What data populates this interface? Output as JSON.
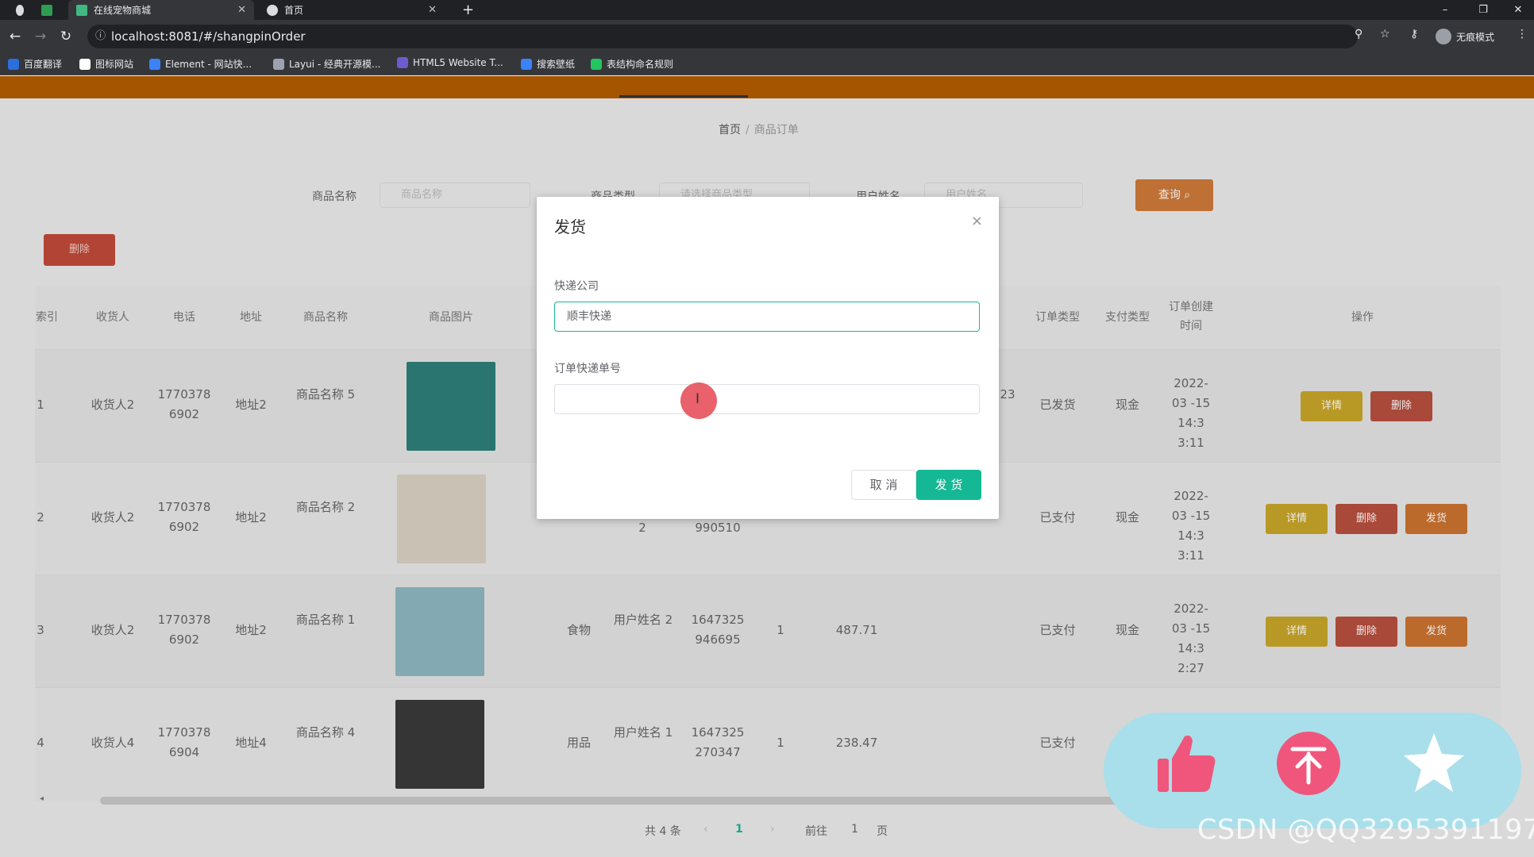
{
  "browser": {
    "tabs": [
      {
        "title": "在线宠物商城",
        "active": true
      },
      {
        "title": "首页",
        "active": false
      }
    ],
    "new_tab": "+",
    "window_controls": [
      "–",
      "❐",
      "✕"
    ],
    "url": "localhost:8081/#/shangpinOrder",
    "incognito_label": "无痕模式",
    "bookmarks": [
      {
        "label": "百度翻译",
        "color": "#2a6fdb"
      },
      {
        "label": "图标网站",
        "color": "#ffffff"
      },
      {
        "label": "Element - 网站快...",
        "color": "#3b82f6"
      },
      {
        "label": "Layui - 经典开源模...",
        "color": "#9ca3af"
      },
      {
        "label": "HTML5 Website T...",
        "color": "#6d5bd0"
      },
      {
        "label": "搜索壁纸",
        "color": "#3b82f6"
      },
      {
        "label": "表结构命名规则",
        "color": "#22c55e"
      }
    ]
  },
  "page": {
    "breadcrumb": {
      "home": "首页",
      "separator": "/",
      "current": "商品订单"
    },
    "search": {
      "fields": [
        {
          "label": "商品名称",
          "placeholder": "商品名称"
        },
        {
          "label": "商品类型",
          "placeholder": "请选择商品类型"
        },
        {
          "label": "用户姓名",
          "placeholder": "用户姓名"
        }
      ],
      "query_button": "查询 ⌕"
    },
    "delete_button": "删除",
    "table": {
      "headers": [
        "索引",
        "收货人",
        "电话",
        "地址",
        "商品名称",
        "商品图片",
        "订单类型",
        "支付类型",
        "订单创建时间",
        "操作"
      ],
      "rows": [
        {
          "index": "1",
          "receiver": "收货人2",
          "phone": "1770378 6902",
          "address": "地址2",
          "product": "商品名称 5",
          "type": "",
          "user": "",
          "order_no": "",
          "qty": "",
          "price": "",
          "extra": "23",
          "status": "已发货",
          "pay": "现金",
          "created": "2022-03 -15 14:3 3:11",
          "thumb_color": "#2e7f7a",
          "ops": [
            "详情",
            "删除"
          ]
        },
        {
          "index": "2",
          "receiver": "收货人2",
          "phone": "1770378 6902",
          "address": "地址2",
          "product": "商品名称 2",
          "type": "",
          "user": "2",
          "order_no": "990510",
          "qty": "",
          "price": "",
          "extra": "",
          "status": "已支付",
          "pay": "现金",
          "created": "2022-03 -15 14:3 3:11",
          "thumb_color": "#d9d2c4",
          "ops": [
            "详情",
            "删除",
            "发货"
          ]
        },
        {
          "index": "3",
          "receiver": "收货人2",
          "phone": "1770378 6902",
          "address": "地址2",
          "product": "商品名称 1",
          "type": "食物",
          "user": "用户姓名 2",
          "order_no": "1647325 946695",
          "qty": "1",
          "price": "487.71",
          "extra": "",
          "status": "已支付",
          "pay": "现金",
          "created": "2022-03 -15 14:3 2:27",
          "thumb_color": "#8fb8c2",
          "ops": [
            "详情",
            "删除",
            "发货"
          ]
        },
        {
          "index": "4",
          "receiver": "收货人4",
          "phone": "1770378 6904",
          "address": "地址4",
          "product": "商品名称 4",
          "type": "用品",
          "user": "用户姓名 1",
          "order_no": "1647325 270347",
          "qty": "1",
          "price": "238.47",
          "extra": "",
          "status": "已支付",
          "pay": "",
          "created": "",
          "thumb_color": "#3a3a3a",
          "ops": []
        }
      ]
    },
    "pagination": {
      "total": "共 4 条",
      "prev": "‹",
      "current_page": "1",
      "next": "›",
      "goto": "前往",
      "goto_value": "1",
      "page_suffix": "页"
    },
    "scroll_left": "◂"
  },
  "dialog": {
    "title": "发货",
    "close": "×",
    "courier_label": "快递公司",
    "courier_value": "顺丰快递",
    "tracking_label": "订单快递单号",
    "tracking_value": "",
    "cancel_button": "取 消",
    "confirm_button": "发 货",
    "cursor_glyph": "I"
  },
  "overlay": {
    "watermark": "CSDN @QQ3295391197",
    "icons": [
      "thumb-up-icon",
      "pin-top-icon",
      "star-icon"
    ],
    "bg": "#a9dfea",
    "pink": "#f0567c"
  }
}
